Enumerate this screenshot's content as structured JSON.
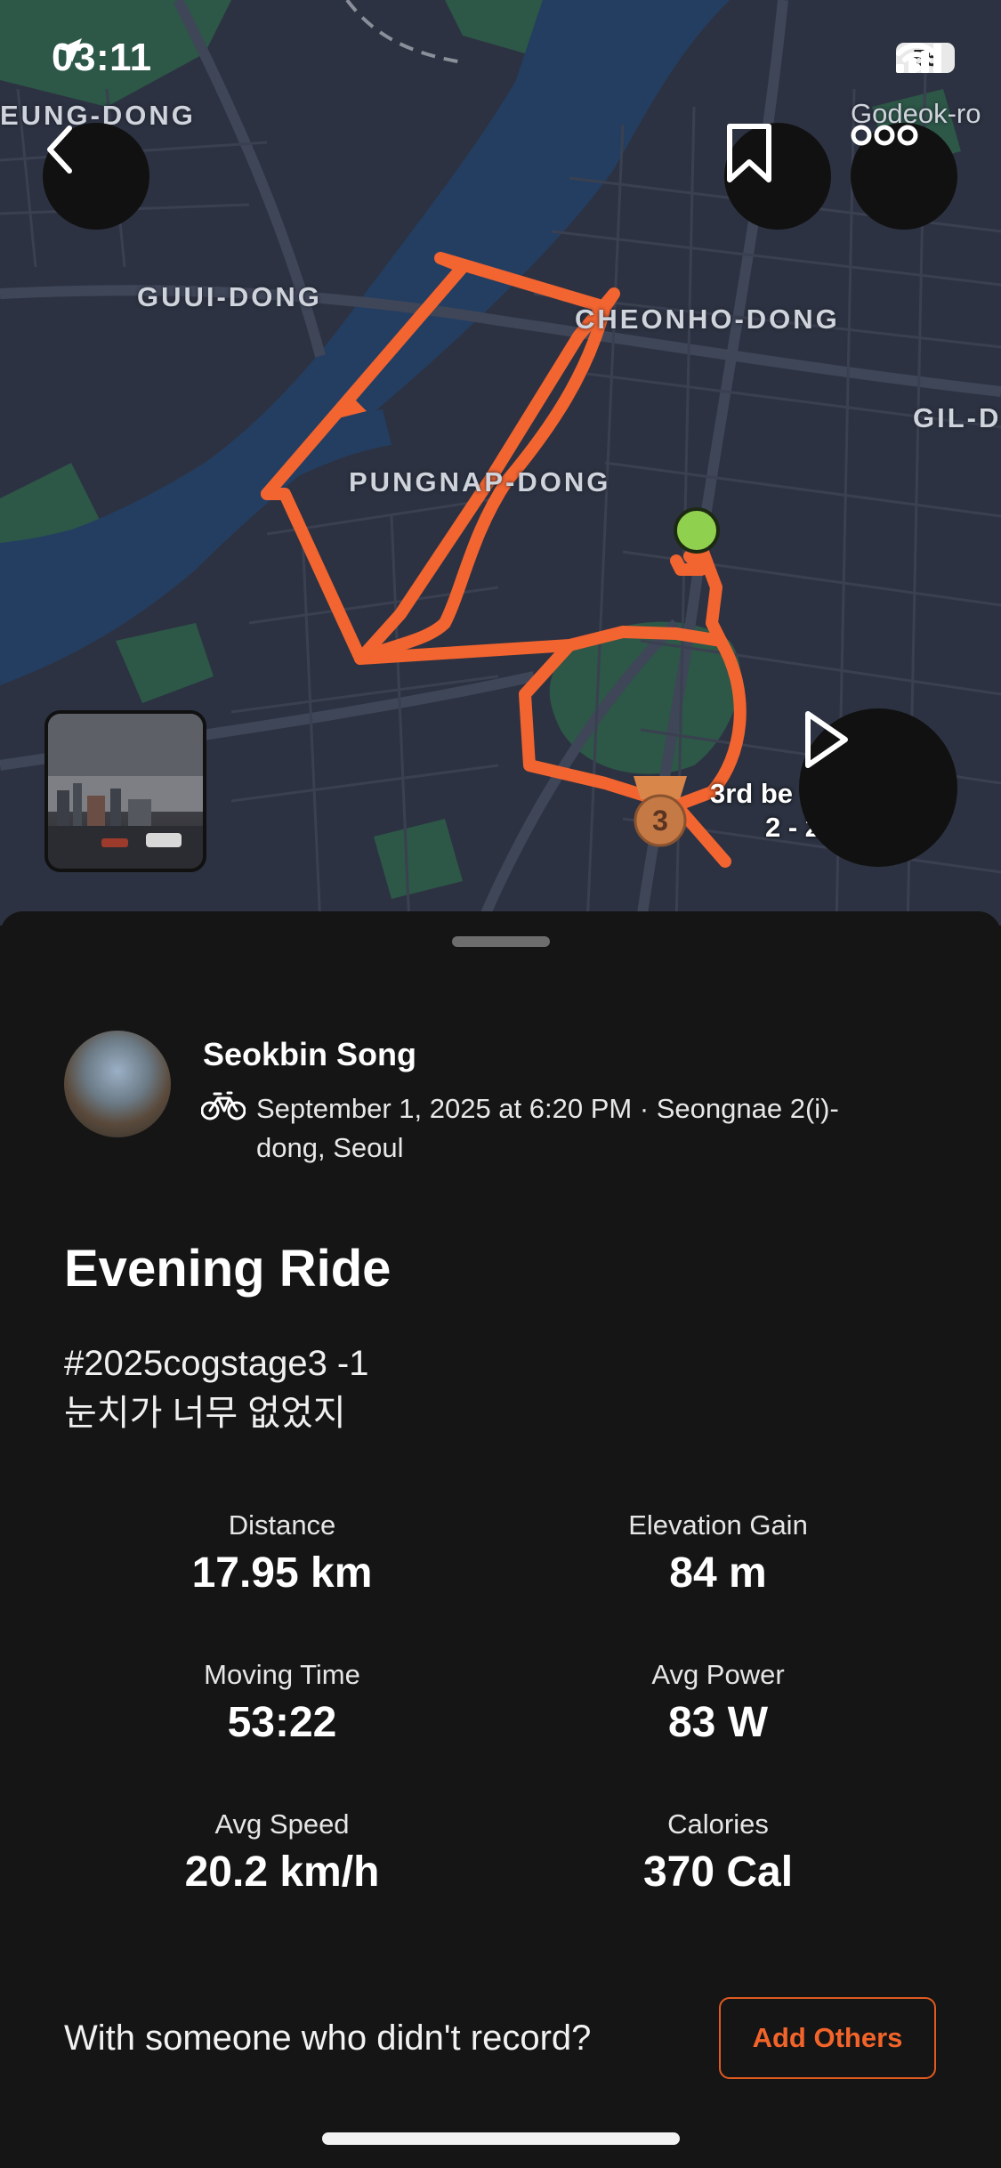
{
  "status_bar": {
    "time": "03:11",
    "battery": "55"
  },
  "map": {
    "place_labels": {
      "eung_dong": "EUNG-DONG",
      "godeok_ro": "Godeok-ro",
      "guui_dong": "GUUI-DONG",
      "cheonho_dong": "CHEONHO-DONG",
      "gil_d": "GIL-D",
      "pungnap_dong": "PUNGNAP-DONG"
    },
    "segment_badge": "3",
    "segment_label_line1": "3rd be",
    "segment_label_line2": "2 - 2",
    "route_color": "#f26430",
    "start_marker_color": "#8fd14f"
  },
  "activity": {
    "athlete_name": "Seokbin Song",
    "meta_line1": "September 1, 2025 at 6:20 PM · Seongnae 2(i)-",
    "meta_line2": "dong, Seoul",
    "title": "Evening Ride",
    "description_line1": "#2025cogstage3 -1",
    "description_line2": "눈치가 너무 없었지",
    "stats": [
      {
        "label": "Distance",
        "value": "17.95 km"
      },
      {
        "label": "Elevation Gain",
        "value": "84 m"
      },
      {
        "label": "Moving Time",
        "value": "53:22"
      },
      {
        "label": "Avg Power",
        "value": "83 W"
      },
      {
        "label": "Avg Speed",
        "value": "20.2 km/h"
      },
      {
        "label": "Calories",
        "value": "370 Cal"
      }
    ],
    "with_others_prompt": "With someone who didn't record?",
    "add_others_label": "Add Others"
  },
  "icons": [
    "location-arrow-icon",
    "signal-icon",
    "wifi-icon",
    "back-chevron-icon",
    "bookmark-icon",
    "more-icon",
    "play-icon",
    "bike-icon",
    "medal-icon"
  ],
  "colors": {
    "accent": "#f2642a",
    "background": "#151515"
  }
}
